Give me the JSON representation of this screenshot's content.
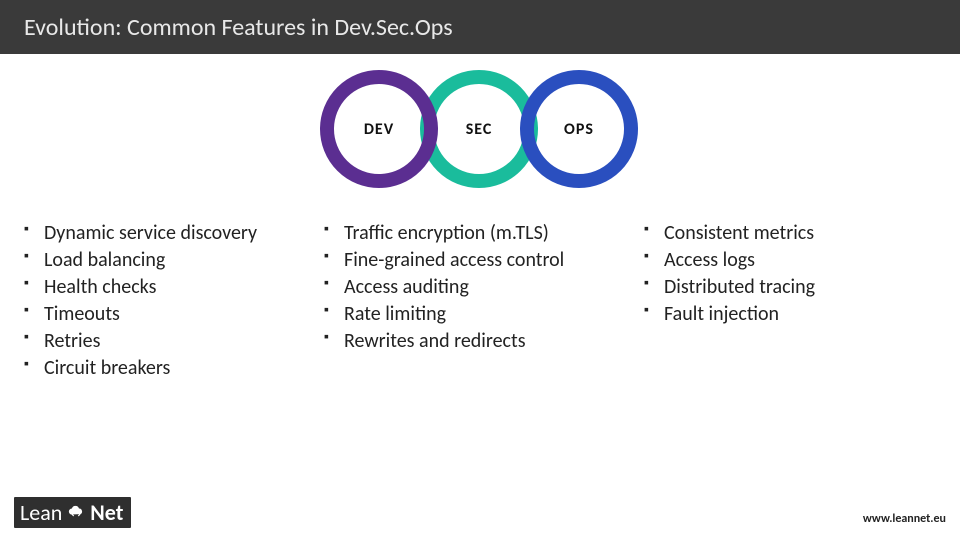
{
  "title": "Evolution: Common Features in Dev.Sec.Ops",
  "rings": {
    "dev": "DEV",
    "sec": "SEC",
    "ops": "OPS"
  },
  "columns": {
    "dev": [
      "Dynamic service discovery",
      "Load balancing",
      "Health checks",
      "Timeouts",
      "Retries",
      "Circuit breakers"
    ],
    "sec": [
      "Traffic encryption (m.TLS)",
      "Fine-grained access control",
      "Access auditing",
      "Rate limiting",
      "Rewrites and redirects"
    ],
    "ops": [
      "Consistent metrics",
      "Access logs",
      "Distributed tracing",
      "Fault injection"
    ]
  },
  "footer": {
    "brand_lean": "Lean",
    "brand_net": "Net",
    "url": "www.leannet.eu"
  },
  "colors": {
    "dev": "#5b2e91",
    "sec": "#1abc9c",
    "ops": "#2a4fbf",
    "header": "#3a3a3a"
  }
}
